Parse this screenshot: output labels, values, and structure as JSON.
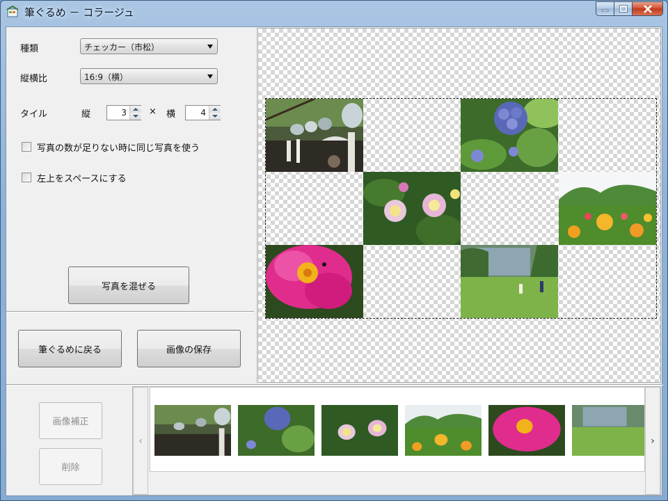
{
  "window": {
    "title": "筆ぐるめ － コラージュ",
    "caption_buttons": [
      "minimize",
      "maximize",
      "close"
    ]
  },
  "settings": {
    "type_label": "種類",
    "type_value": "チェッカー（市松）",
    "ratio_label": "縦横比",
    "ratio_value": "16:9（横）",
    "tile_label": "タイル",
    "rows_label": "縦",
    "rows_value": "3",
    "times_symbol": "×",
    "cols_label": "横",
    "cols_value": "4",
    "reuse_photos_label": "写真の数が足りない時に同じ写真を使う",
    "reuse_photos_checked": false,
    "top_left_space_label": "左上をスペースにする",
    "top_left_space_checked": false
  },
  "buttons": {
    "shuffle": "写真を混ぜる",
    "back": "筆ぐるめに戻る",
    "save": "画像の保存",
    "correct": "画像補正",
    "delete": "削除"
  },
  "collage": {
    "pattern": "checker",
    "grid": {
      "rows": 3,
      "cols": 4
    },
    "tiles": [
      "wind-chimes",
      "space",
      "hydrangea",
      "space",
      "space",
      "lantana",
      "space",
      "flower-field",
      "portulaca",
      "space",
      "park-field",
      "space"
    ]
  },
  "thumbnails": [
    "wind-chimes",
    "hydrangea",
    "lantana",
    "flower-field",
    "portulaca",
    "park-field"
  ],
  "strip": {
    "prev_arrow": "‹",
    "next_arrow": "›"
  },
  "colors": {
    "window_frame": "#8fb3d8",
    "client_bg": "#f0f0f0",
    "close_button": "#c13a1e"
  }
}
